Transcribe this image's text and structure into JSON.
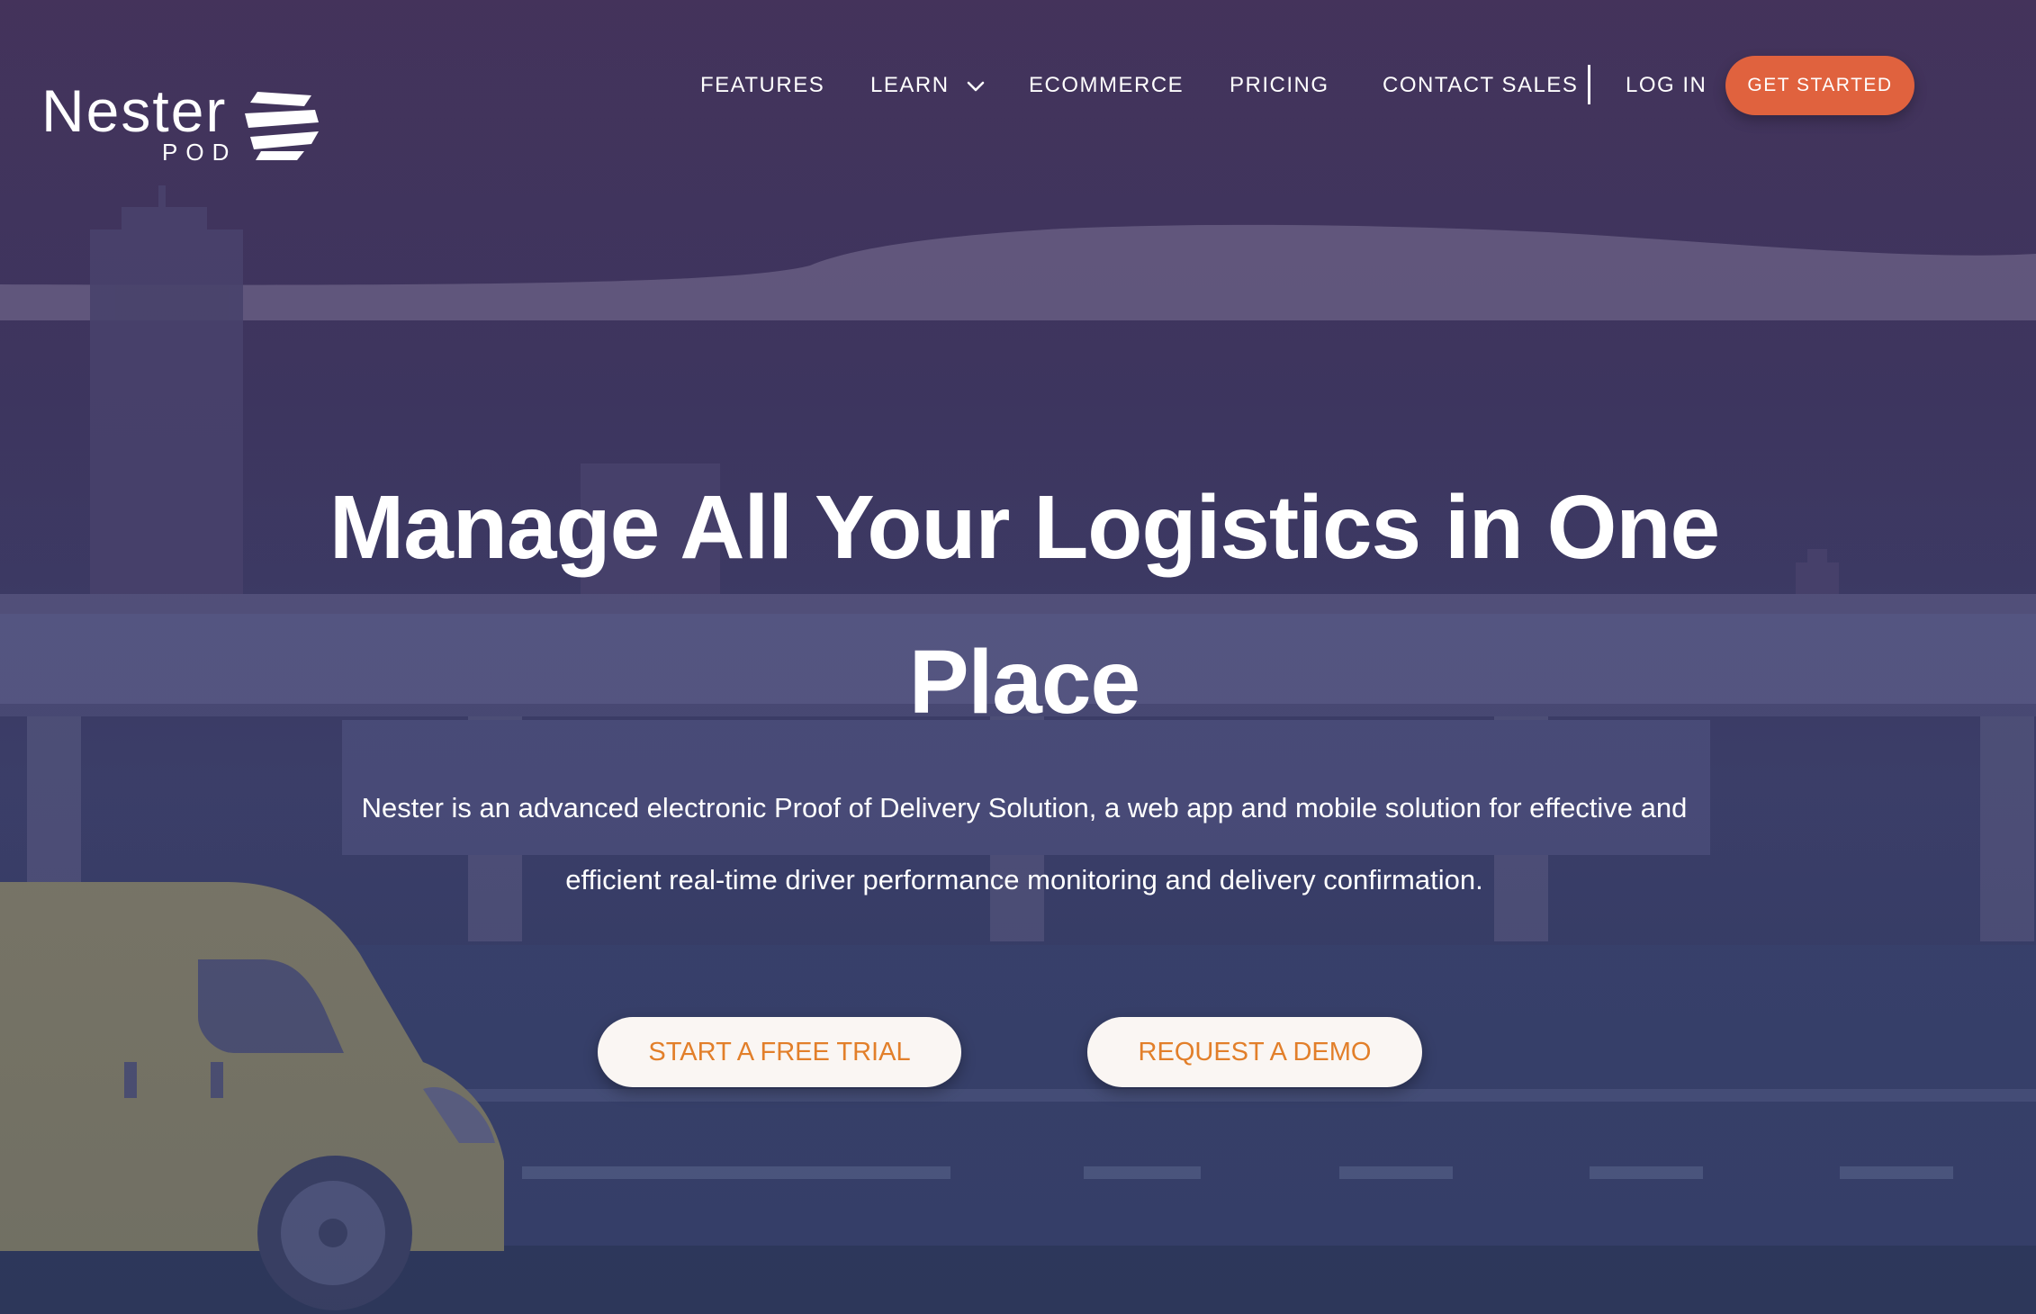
{
  "brand": {
    "name": "Nester",
    "sub": "POD",
    "logo_icon": "nester-logo-mark",
    "accent": "#e0623e",
    "button_text_color": "#e27f2a"
  },
  "nav": {
    "features": "FEATURES",
    "learn": "LEARN",
    "ecommerce": "ECOMMERCE",
    "pricing": "PRICING",
    "contact": "CONTACT SALES",
    "login": "LOG IN",
    "cta": "GET STARTED"
  },
  "hero": {
    "title": "Manage All Your Logistics in One Place",
    "description": "Nester is an advanced electronic Proof of Delivery Solution, a web app and mobile solution for effective and efficient real-time driver performance monitoring and delivery confirmation.",
    "primary_button": "START A FREE TRIAL",
    "secondary_button": "REQUEST A DEMO"
  }
}
